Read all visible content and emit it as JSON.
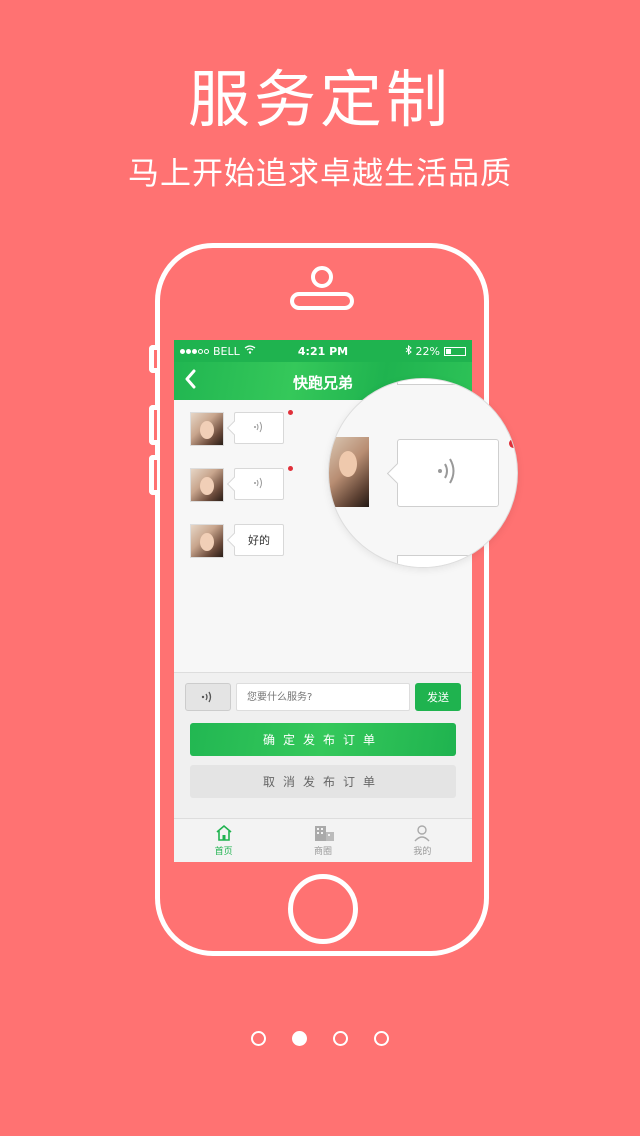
{
  "hero": {
    "title": "服务定制",
    "subtitle": "马上开始追求卓越生活品质"
  },
  "status_bar": {
    "carrier": "BELL",
    "time": "4:21 PM",
    "battery": "22%"
  },
  "nav": {
    "title": "快跑兄弟"
  },
  "messages": [
    {
      "type": "voice",
      "unread": true
    },
    {
      "type": "voice",
      "unread": true
    },
    {
      "type": "text",
      "text": "好的"
    }
  ],
  "composer": {
    "placeholder": "您要什么服务?",
    "send_label": "发送"
  },
  "actions": {
    "confirm_label": "确定发布订单",
    "cancel_label": "取消发布订单"
  },
  "tabs": [
    {
      "label": "首页",
      "icon": "home-icon",
      "active": true
    },
    {
      "label": "商圈",
      "icon": "building-icon",
      "active": false
    },
    {
      "label": "我的",
      "icon": "user-icon",
      "active": false
    }
  ],
  "pager": {
    "count": 4,
    "current": 2
  },
  "colors": {
    "background": "#ff7272",
    "accent": "#1fb34f",
    "unread": "#e0303a"
  }
}
